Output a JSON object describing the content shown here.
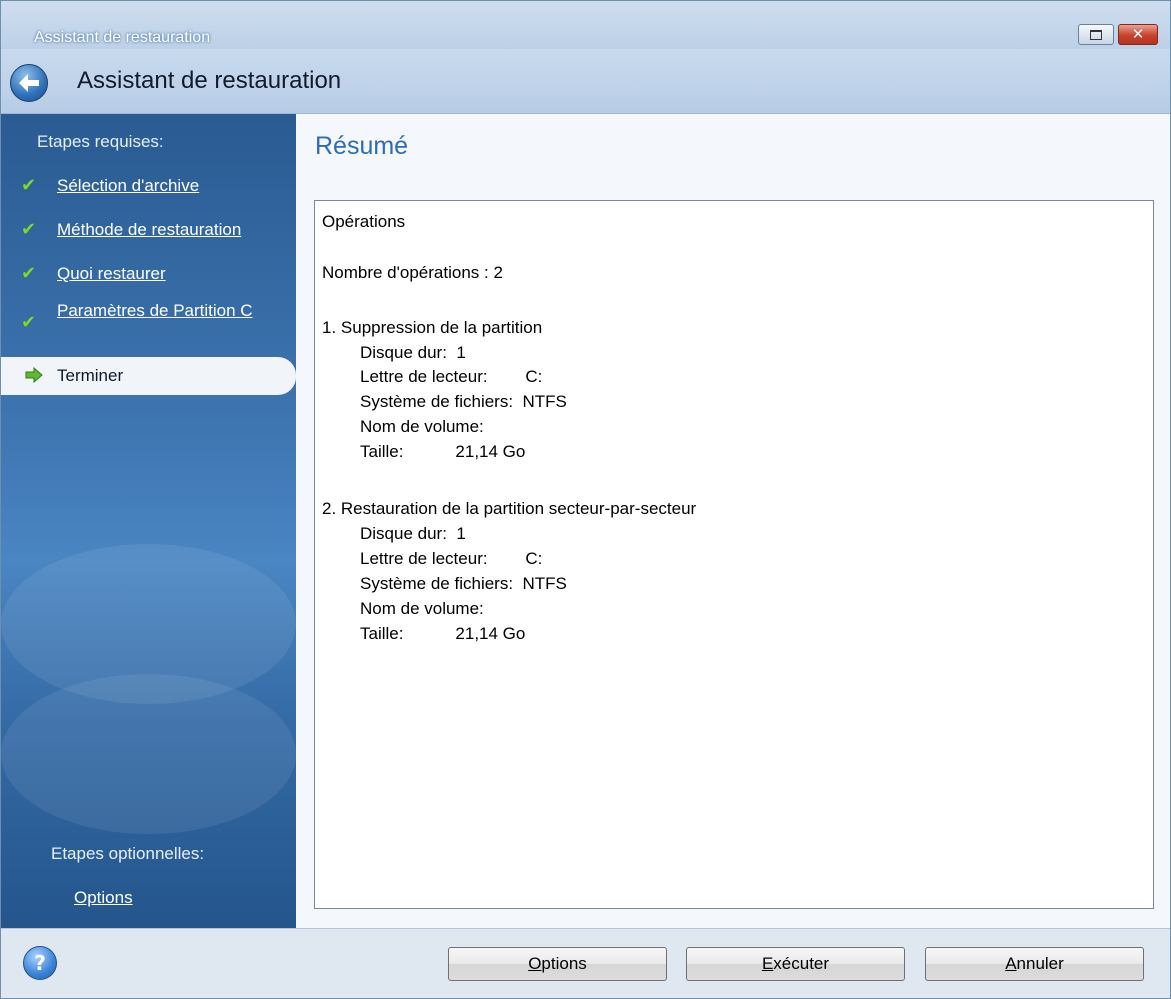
{
  "window": {
    "title": "Assistant de restauration"
  },
  "header": {
    "title": "Assistant de restauration"
  },
  "sidebar": {
    "required_heading": "Etapes requises:",
    "steps": [
      {
        "label": "Sélection d'archive",
        "state": "done"
      },
      {
        "label": "Méthode de restauration",
        "state": "done"
      },
      {
        "label": "Quoi restaurer",
        "state": "done"
      },
      {
        "label": "Paramètres de Partition C",
        "state": "done"
      }
    ],
    "current_step": {
      "label": "Terminer"
    },
    "optional_heading": "Etapes optionnelles:",
    "optional_link": "Options"
  },
  "main": {
    "title": "Résumé",
    "summary": {
      "heading": "Opérations",
      "count": "Nombre d'opérations : 2",
      "op1": {
        "title": "1. Suppression de la partition",
        "disk": "Disque dur:  1",
        "letter": "Lettre de lecteur:        C:",
        "fs": "Système de fichiers:  NTFS",
        "volume": "Nom de volume:",
        "size": "Taille:           21,14 Go"
      },
      "op2": {
        "title": "2. Restauration de la partition secteur-par-secteur",
        "disk": "Disque dur:  1",
        "letter": "Lettre de lecteur:        C:",
        "fs": "Système de fichiers:  NTFS",
        "volume": "Nom de volume:",
        "size": "Taille:           21,14 Go"
      }
    }
  },
  "footer": {
    "help_icon": "help-icon",
    "buttons": {
      "options_first": "O",
      "options_rest": "ptions",
      "execute_first": "E",
      "execute_rest": "xécuter",
      "cancel_first": "A",
      "cancel_rest": "nnuler"
    }
  },
  "colors": {
    "accent": "#2e6cb6",
    "sidebar": "#3f77b3",
    "check": "#7cd63a"
  }
}
